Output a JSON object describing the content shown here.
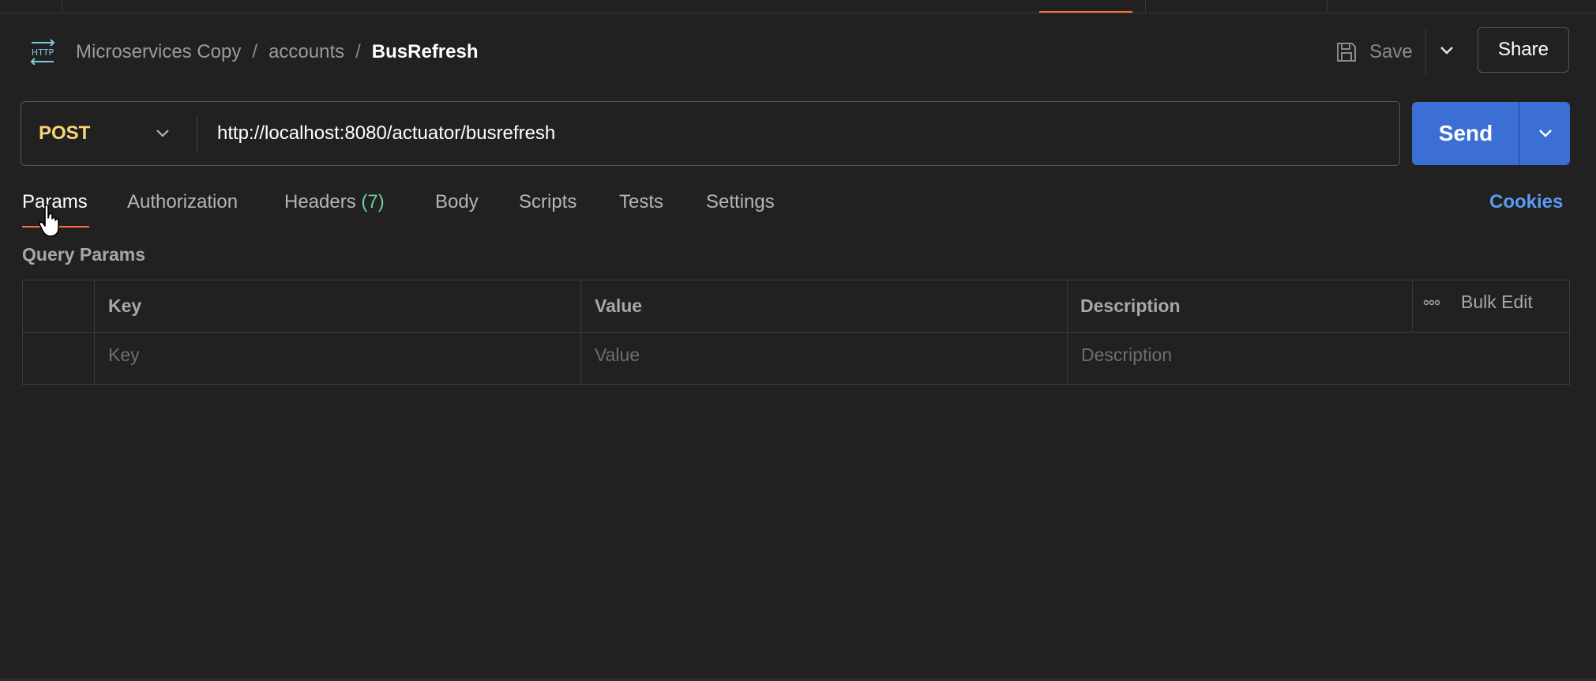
{
  "breadcrumb": {
    "collection": "Microservices Copy",
    "folder": "accounts",
    "separator": "/",
    "request": "BusRefresh"
  },
  "header": {
    "save_label": "Save",
    "share_label": "Share"
  },
  "request": {
    "method": "POST",
    "url": "http://localhost:8080/actuator/busrefresh",
    "send_label": "Send"
  },
  "tabs": [
    {
      "label": "Params"
    },
    {
      "label": "Authorization"
    },
    {
      "label": "Headers",
      "count": "(7)"
    },
    {
      "label": "Body"
    },
    {
      "label": "Scripts"
    },
    {
      "label": "Tests"
    },
    {
      "label": "Settings"
    }
  ],
  "cookies_label": "Cookies",
  "query_params": {
    "title": "Query Params",
    "columns": [
      "Key",
      "Value",
      "Description"
    ],
    "bulk_edit_label": "Bulk Edit",
    "placeholders": {
      "key": "Key",
      "value": "Value",
      "description": "Description"
    }
  },
  "colors": {
    "method_post": "#f7d774",
    "send": "#3b6fd4",
    "accent": "#ff6c37",
    "cookies": "#5b9bf0",
    "headers_count": "#6fcf97"
  }
}
